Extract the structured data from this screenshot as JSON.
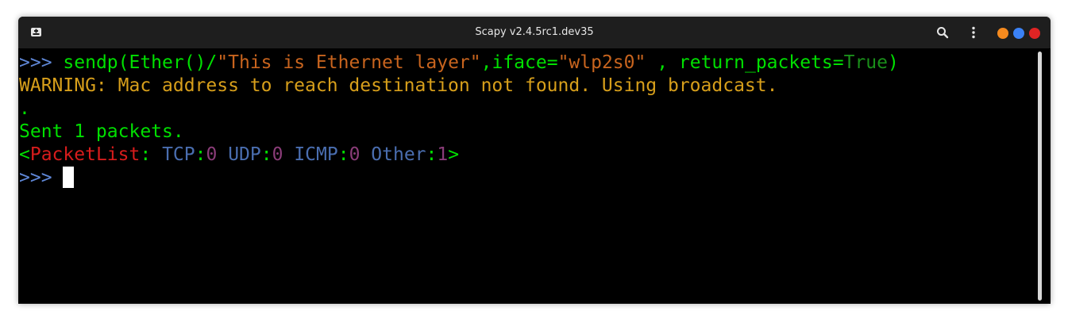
{
  "window": {
    "title": "Scapy v2.4.5rc1.dev35"
  },
  "colors": {
    "prompt": "#5f87d7",
    "code_green": "#00e000",
    "string_orange": "#c8641e",
    "true_green": "#1a8f1a",
    "warning_yellow": "#d79f1b",
    "packetlist_red": "#d71c1c",
    "proto_blue": "#4a6eb0",
    "count_purple": "#8a3c78",
    "btn_minimize": "#f58a1e",
    "btn_maximize": "#3b82f6",
    "btn_close": "#e02424"
  },
  "icons": {
    "new_tab": "new-tab-icon",
    "search": "search-icon",
    "menu": "kebab-menu-icon"
  },
  "terminal": {
    "prompt": ">>>",
    "command": {
      "fn": "sendp(Ether()/",
      "payload": "\"This is Ethernet layer\"",
      "iface_kw": ",iface=",
      "iface_val": "\"wlp2s0\"",
      "ret_kw": " , return_packets=",
      "ret_val": "True",
      "close": ")"
    },
    "warning": "WARNING: Mac address to reach destination not found. Using broadcast.",
    "dot": ".",
    "sent": "Sent 1 packets.",
    "result": {
      "open": "<",
      "name": "PacketList",
      "colon": ":",
      "tcp_label": "TCP",
      "tcp_count": "0",
      "udp_label": "UDP",
      "udp_count": "0",
      "icmp_label": "ICMP",
      "icmp_count": "0",
      "other_label": "Other",
      "other_count": "1",
      "close": ">"
    }
  }
}
